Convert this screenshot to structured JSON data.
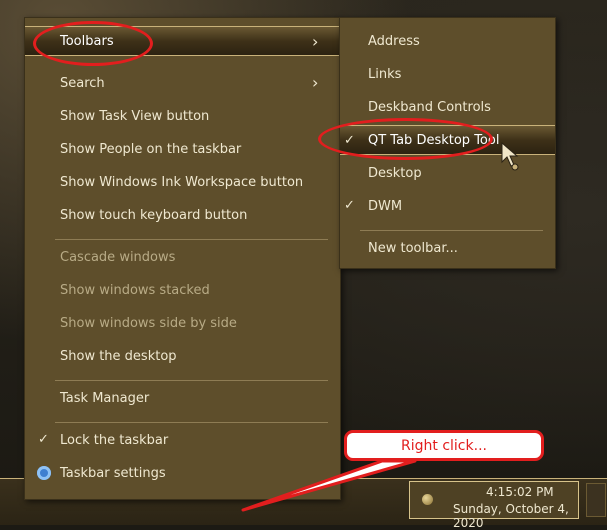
{
  "main_menu": {
    "toolbars": "Toolbars",
    "search": "Search",
    "show_task_view": "Show Task View button",
    "show_people": "Show People on the taskbar",
    "show_ink": "Show Windows Ink Workspace button",
    "show_touch_keyboard": "Show touch keyboard button",
    "cascade": "Cascade windows",
    "stacked": "Show windows stacked",
    "side_by_side": "Show windows side by side",
    "show_desktop": "Show the desktop",
    "task_manager": "Task Manager",
    "lock_taskbar": "Lock the taskbar",
    "taskbar_settings": "Taskbar settings"
  },
  "sub_menu": {
    "address": "Address",
    "links": "Links",
    "deskband": "Deskband Controls",
    "qttab": "QT Tab Desktop Tool",
    "desktop": "Desktop",
    "dwm": "DWM",
    "new_toolbar": "New toolbar..."
  },
  "clock": {
    "time": "4:15:02 PM",
    "date": "Sunday, October 4, 2020"
  },
  "annotation": {
    "callout_text": "Right click..."
  },
  "icons": {
    "submenu_arrow": "chevron-right-icon",
    "check": "checkmark-icon",
    "settings": "gear-icon"
  },
  "colors": {
    "menu_bg": "#5e4e2b",
    "menu_text": "#efe8d0",
    "disabled_text": "#b8ab86",
    "annotation_red": "#e21e1e",
    "highlight_border": "#c9b27a"
  }
}
